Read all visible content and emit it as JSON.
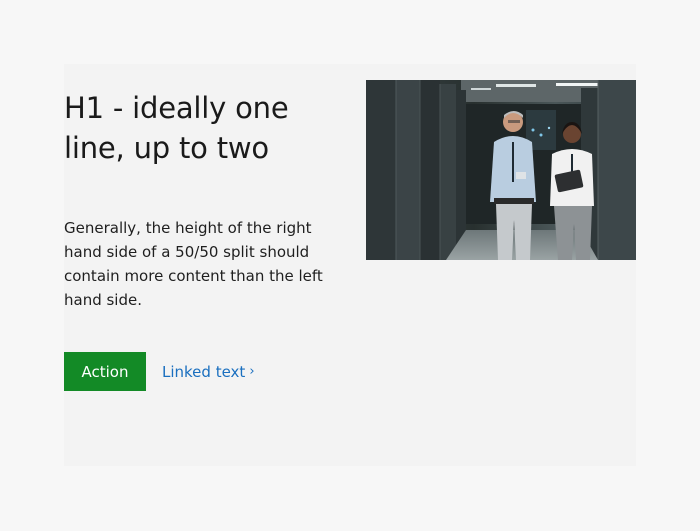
{
  "content": {
    "heading": "H1 - ideally one line, up to two",
    "body": "Generally, the height of the right hand side of a 50/50 split should contain more content than the left hand side.",
    "action_label": "Action",
    "link_label": "Linked text",
    "link_chevron": "›"
  },
  "image": {
    "subject": "server-room-photo",
    "alt": ""
  },
  "colors": {
    "page_bg": "#f7f7f7",
    "card_bg": "#f3f3f3",
    "button_bg": "#138a26",
    "button_text": "#ffffff",
    "link_text": "#1a6fbf",
    "text": "#1a1a1a"
  }
}
